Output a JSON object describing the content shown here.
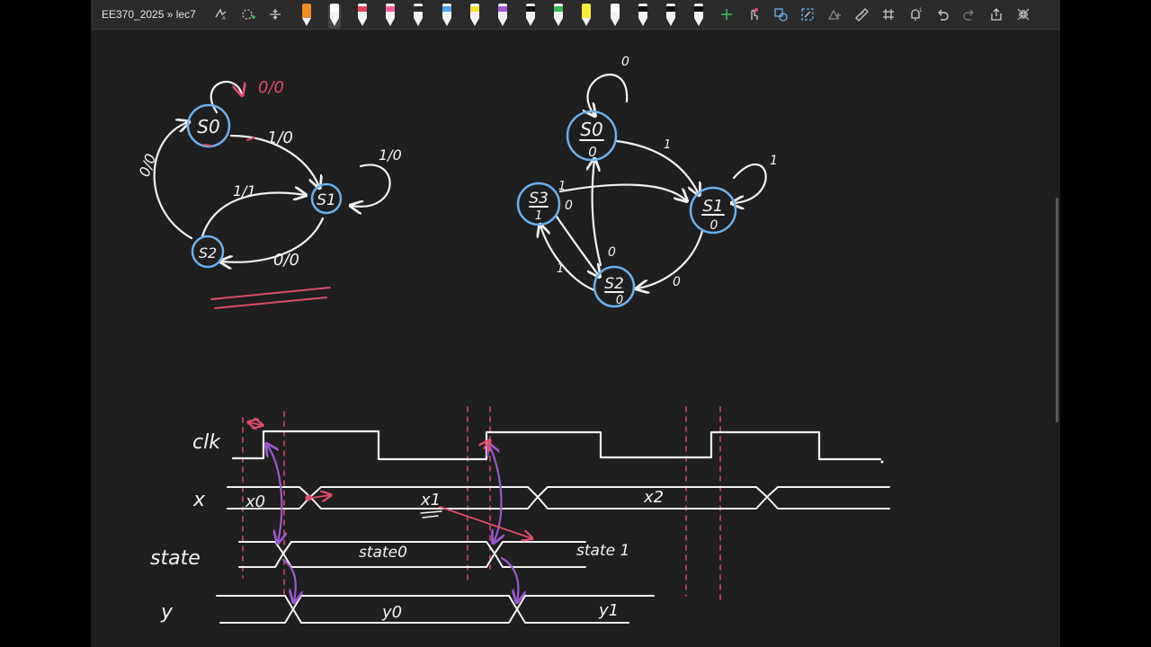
{
  "toolbar": {
    "breadcrumb": "EE370_2025 » lec7",
    "left_tools": [
      "lasso-select-icon",
      "add-space-icon",
      "insert-space-icon"
    ],
    "right_tools": [
      "add-pen-icon",
      "touch-write-icon",
      "shapes-icon",
      "ink-to-shape-icon",
      "ink-to-math-icon",
      "ruler-icon",
      "grid-icon",
      "notification-icon",
      "undo-icon",
      "redo-icon",
      "share-icon",
      "collapse-icon"
    ],
    "pens": [
      {
        "name": "orange-highlighter",
        "color": "#f08a24"
      },
      {
        "name": "white-pen",
        "color": "#ffffff"
      },
      {
        "name": "red-pen",
        "color": "#e8405a"
      },
      {
        "name": "pink-pen",
        "color": "#ff5fa2"
      },
      {
        "name": "dark-pen",
        "color": "#2a2a2a"
      },
      {
        "name": "blue-pen",
        "color": "#4aa3ff"
      },
      {
        "name": "yellow-pen",
        "color": "#f5e52a"
      },
      {
        "name": "purple-pen",
        "color": "#a55bd6"
      },
      {
        "name": "black-pen",
        "color": "#111111"
      },
      {
        "name": "green-pen",
        "color": "#2fbf4a"
      },
      {
        "name": "yellow-highlighter",
        "color": "#f7ea3a"
      },
      {
        "name": "gray-pen",
        "color": "#ffffff"
      },
      {
        "name": "black-pen-2",
        "color": "#111111"
      },
      {
        "name": "black-pen-3",
        "color": "#111111"
      },
      {
        "name": "black-pen-4",
        "color": "#111111"
      }
    ]
  },
  "diagram_left": {
    "states": [
      "S0",
      "S1",
      "S2"
    ],
    "labels": {
      "s0_self": "0/0",
      "s0_s1": "1/0",
      "s1_self": "1/0",
      "s2_s1": "1/1",
      "s1_s2": "0/0",
      "s2_s0": "0/0"
    }
  },
  "diagram_right": {
    "states": [
      {
        "name": "S0",
        "out": "0"
      },
      {
        "name": "S1",
        "out": "0"
      },
      {
        "name": "S2",
        "out": "0"
      },
      {
        "name": "S3",
        "out": "1"
      }
    ],
    "labels": {
      "s0_self": "0",
      "s0_s1": "1",
      "s1_self": "1",
      "s3_s1": "1",
      "s3_s2": "0",
      "s2_s0": "0",
      "s2_s3": "1",
      "s1_s2": "0"
    }
  },
  "timing": {
    "signals": [
      "clk",
      "x",
      "state",
      "y"
    ],
    "x_values": [
      "x0",
      "x1",
      "x2"
    ],
    "state_values": [
      "state0",
      "state 1"
    ],
    "y_values": [
      "y0",
      "y1"
    ]
  },
  "colors": {
    "accent": "#6ab0ef",
    "ink": "#f2f2f2",
    "purple": "#9b59d0",
    "pink": "#e04b6a",
    "background": "#1f1f1f"
  }
}
